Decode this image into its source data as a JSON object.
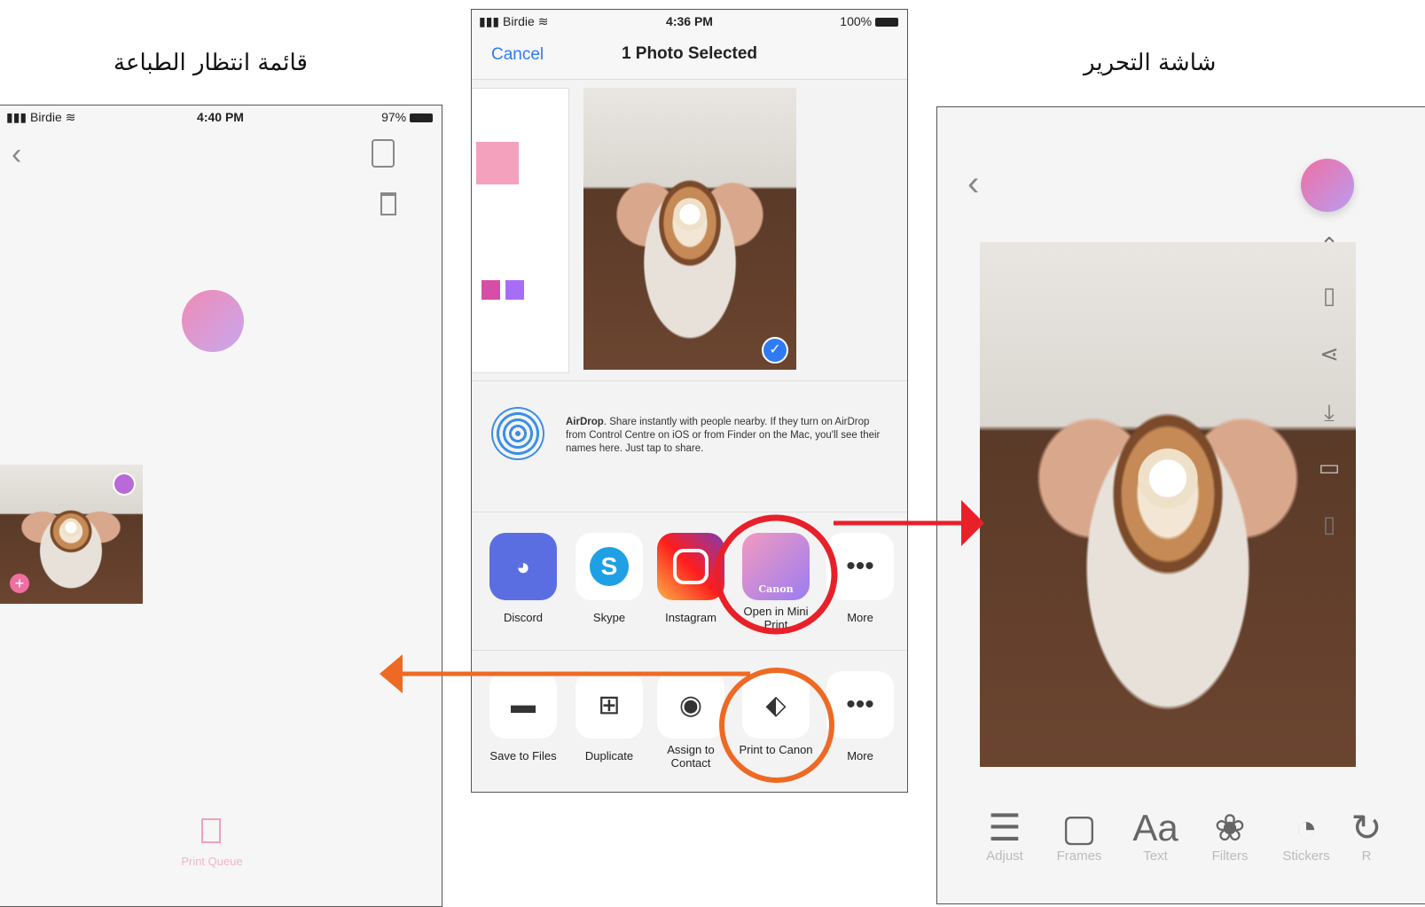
{
  "captions": {
    "left": "قائمة انتظار الطباعة",
    "right": "شاشة التحرير"
  },
  "left_screen": {
    "status": {
      "carrier": "Birdie",
      "time": "4:40 PM",
      "battery": "97%"
    },
    "bottom_tab_label": "Print Queue"
  },
  "share_sheet": {
    "status": {
      "carrier": "Birdie",
      "time": "4:36 PM",
      "battery": "100%"
    },
    "cancel_label": "Cancel",
    "title": "1 Photo Selected",
    "airdrop": {
      "title": "AirDrop",
      "text": ". Share instantly with people nearby. If they turn on AirDrop from Control Centre on iOS or from Finder on the Mac, you'll see their names here. Just tap to share."
    },
    "apps": [
      {
        "label": "Discord"
      },
      {
        "label": "Skype"
      },
      {
        "label": "Instagram"
      },
      {
        "label": "Open in Mini Print"
      },
      {
        "label": "More"
      }
    ],
    "actions": [
      {
        "label": "Save to Files"
      },
      {
        "label": "Duplicate"
      },
      {
        "label": "Assign to Contact"
      },
      {
        "label": "Print to Canon"
      },
      {
        "label": "More"
      }
    ],
    "canon_badge": "Canon",
    "accent_color": "#2f7bf5"
  },
  "edit_screen": {
    "tools": [
      {
        "label": "Adjust",
        "icon": "sliders-icon"
      },
      {
        "label": "Frames",
        "icon": "frame-icon"
      },
      {
        "label": "Text",
        "icon": "text-icon",
        "glyph": "Aa"
      },
      {
        "label": "Filters",
        "icon": "filters-icon"
      },
      {
        "label": "Stickers",
        "icon": "sticker-icon"
      },
      {
        "label": "R",
        "icon": "rotate-icon"
      }
    ]
  },
  "annotations": {
    "red_circle_color": "#e8202a",
    "orange_circle_color": "#ee6a24"
  }
}
